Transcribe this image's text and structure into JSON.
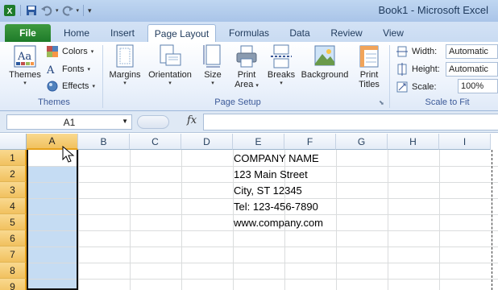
{
  "window": {
    "title": "Book1 - Microsoft Excel"
  },
  "tabs": [
    "File",
    "Home",
    "Insert",
    "Page Layout",
    "Formulas",
    "Data",
    "Review",
    "View"
  ],
  "active_tab": "Page Layout",
  "ribbon": {
    "themes_group": {
      "label": "Themes",
      "themes_button": "Themes",
      "colors": "Colors",
      "fonts": "Fonts",
      "effects": "Effects"
    },
    "page_setup_group": {
      "label": "Page Setup",
      "margins": "Margins",
      "orientation": "Orientation",
      "size": "Size",
      "print_area_1": "Print",
      "print_area_2": "Area",
      "breaks": "Breaks",
      "background": "Background",
      "print_titles_1": "Print",
      "print_titles_2": "Titles"
    },
    "scale_group": {
      "label": "Scale to Fit",
      "width_label": "Width:",
      "width_value": "Automatic",
      "height_label": "Height:",
      "height_value": "Automatic",
      "scale_label": "Scale:",
      "scale_value": "100%"
    }
  },
  "formula_bar": {
    "name_box": "A1",
    "fx": "fx",
    "formula": ""
  },
  "grid": {
    "columns": [
      "A",
      "B",
      "C",
      "D",
      "E",
      "F",
      "G",
      "H",
      "I"
    ],
    "rows": [
      "1",
      "2",
      "3",
      "4",
      "5",
      "6",
      "7",
      "8",
      "9"
    ],
    "cells_E": [
      "COMPANY NAME",
      "123 Main Street",
      "City, ST 12345",
      "Tel: 123-456-7890",
      "www.company.com"
    ],
    "selected_column": "A"
  },
  "colors": {
    "file_tab": "#1e7b2a",
    "selection": "#c5dcf3",
    "header_highlight": "#f1c15f"
  }
}
